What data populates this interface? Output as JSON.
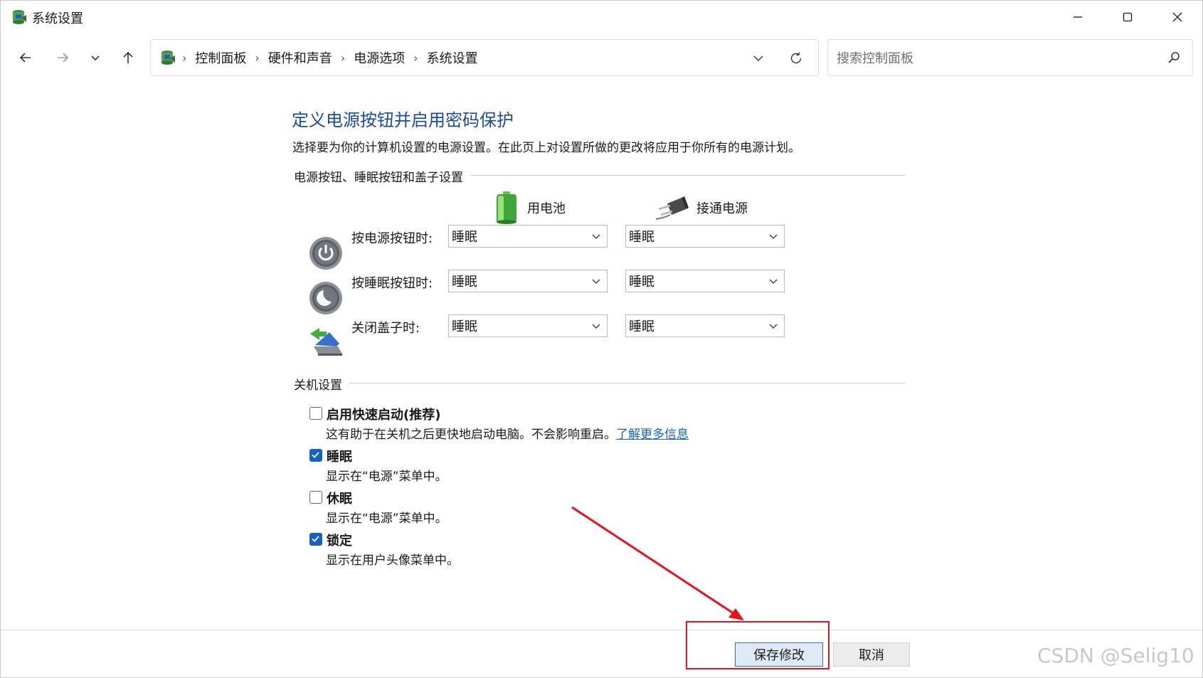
{
  "window": {
    "title": "系统设置",
    "controls": {
      "minimize": "minimize",
      "maximize": "maximize",
      "close": "close"
    }
  },
  "nav": {
    "breadcrumbs": [
      "控制面板",
      "硬件和声音",
      "电源选项",
      "系统设置"
    ],
    "search_placeholder": "搜索控制面板"
  },
  "page": {
    "title": "定义电源按钮并启用密码保护",
    "description": "选择要为你的计算机设置的电源设置。在此页上对设置所做的更改将应用于你所有的电源计划。"
  },
  "power_buttons": {
    "section_title": "电源按钮、睡眠按钮和盖子设置",
    "columns": {
      "battery": "用电池",
      "plugged_in": "接通电源"
    },
    "rows": [
      {
        "label": "按电源按钮时:",
        "battery": "睡眠",
        "plugged_in": "睡眠"
      },
      {
        "label": "按睡眠按钮时:",
        "battery": "睡眠",
        "plugged_in": "睡眠"
      },
      {
        "label": "关闭盖子时:",
        "battery": "睡眠",
        "plugged_in": "睡眠"
      }
    ]
  },
  "shutdown": {
    "section_title": "关机设置",
    "options": [
      {
        "label": "启用快速启动(推荐)",
        "checked": false,
        "desc": "这有助于在关机之后更快地启动电脑。不会影响重启。",
        "link": "了解更多信息"
      },
      {
        "label": "睡眠",
        "checked": true,
        "desc": "显示在“电源”菜单中。"
      },
      {
        "label": "休眠",
        "checked": false,
        "desc": "显示在“电源”菜单中。"
      },
      {
        "label": "锁定",
        "checked": true,
        "desc": "显示在用户头像菜单中。"
      }
    ]
  },
  "footer": {
    "save_label": "保存修改",
    "cancel_label": "取消"
  },
  "watermark": "CSDN @Selig10",
  "colors": {
    "title_blue": "#1b4ba0",
    "link_blue": "#1462c9",
    "annotation_red": "#e8131a"
  }
}
